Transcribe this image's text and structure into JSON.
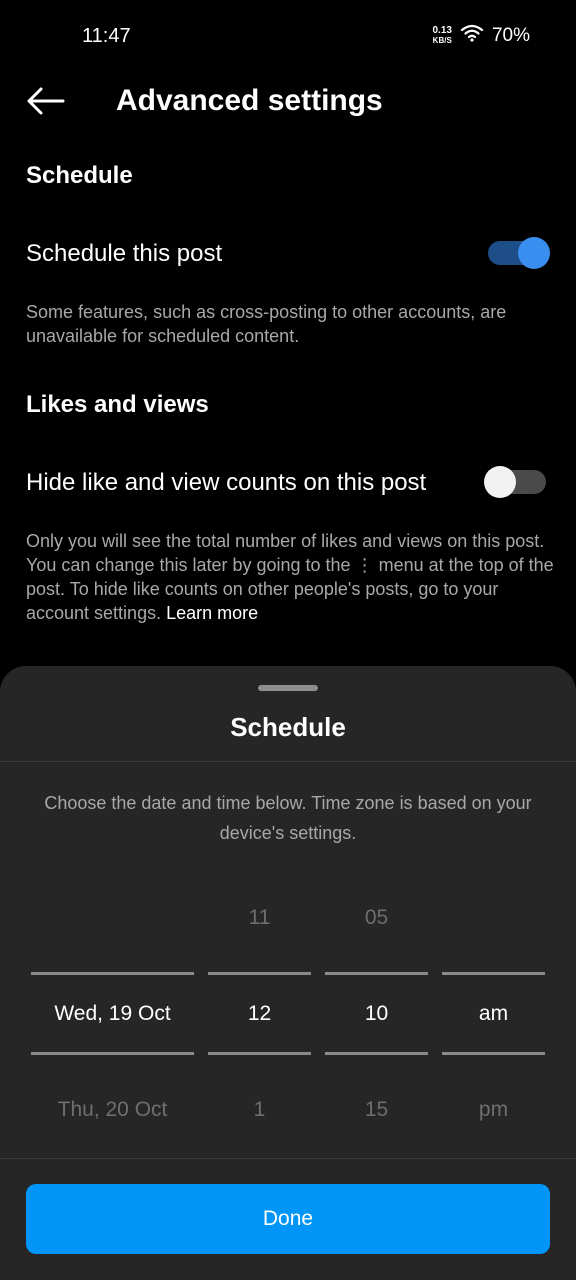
{
  "status_bar": {
    "time": "11:47",
    "net_speed_value": "0.13",
    "net_speed_unit": "KB/S",
    "battery": "70%"
  },
  "header": {
    "title": "Advanced settings",
    "back_icon": "arrow-left-icon"
  },
  "schedule_section": {
    "title": "Schedule",
    "toggle_label": "Schedule this post",
    "toggle_on": true,
    "description": "Some features, such as cross-posting to other accounts, are unavailable for scheduled content."
  },
  "likes_section": {
    "title": "Likes and views",
    "toggle_label": "Hide like and view counts on this post",
    "toggle_on": false,
    "description": "Only you will see the total number of likes and views on this post. You can change this later by going to the ⋮ menu at the top of the post. To hide like counts on other people's posts, go to your account settings.",
    "learn_more": "Learn more"
  },
  "sheet": {
    "title": "Schedule",
    "description": "Choose the date and time below. Time zone is based on your device's settings.",
    "picker": {
      "date": {
        "above": "",
        "selected": "Wed, 19 Oct",
        "below": "Thu, 20 Oct"
      },
      "hour": {
        "above": "11",
        "selected": "12",
        "below": "1"
      },
      "minute": {
        "above": "05",
        "selected": "10",
        "below": "15"
      },
      "ampm": {
        "above": "",
        "selected": "am",
        "below": "pm"
      }
    },
    "done_label": "Done"
  },
  "colors": {
    "accent": "#0095f6",
    "toggle_on_track": "#1d4e87",
    "toggle_on_knob": "#3a8ef0",
    "sheet_bg": "#262626"
  }
}
